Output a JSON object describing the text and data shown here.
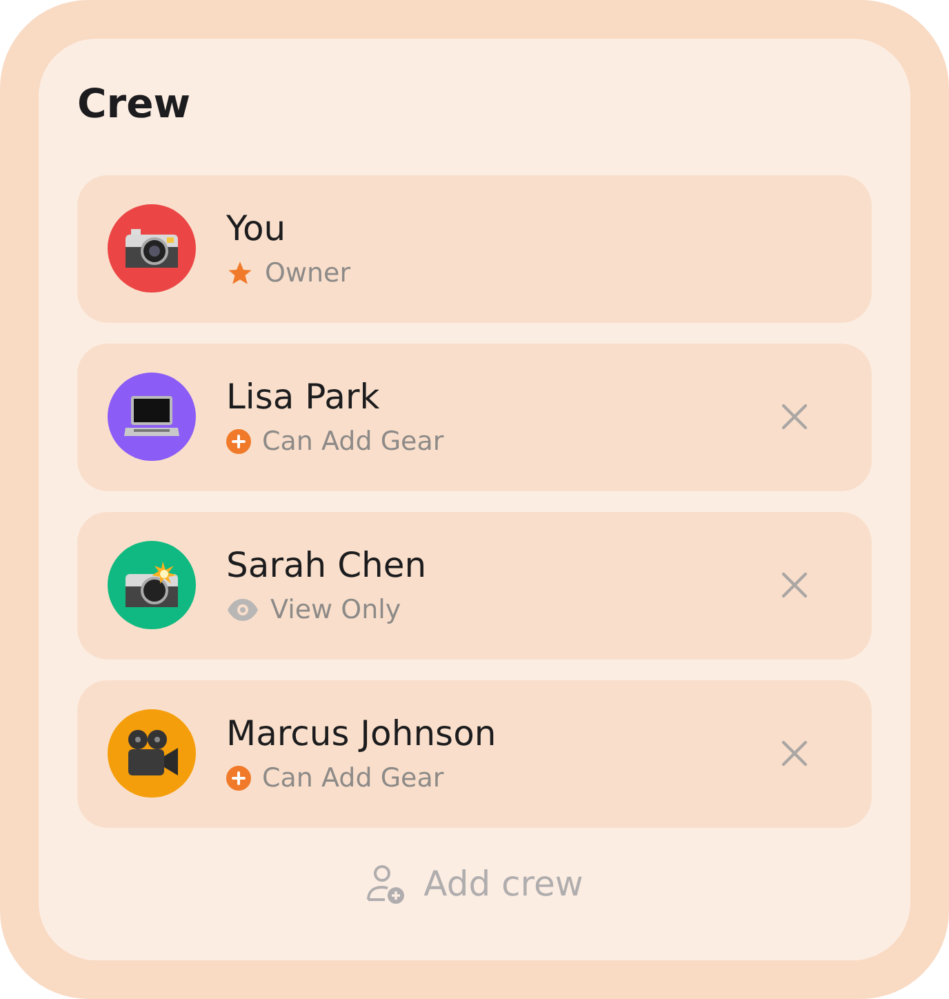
{
  "title": "Crew",
  "members": [
    {
      "name": "You",
      "avatar": {
        "kind": "camera",
        "color": "#ec4545"
      },
      "role": {
        "kind": "owner",
        "label": "Owner"
      },
      "removable": false
    },
    {
      "name": "Lisa Park",
      "avatar": {
        "kind": "laptop",
        "color": "#8b5cf6"
      },
      "role": {
        "kind": "add",
        "label": "Can Add Gear"
      },
      "removable": true
    },
    {
      "name": "Sarah Chen",
      "avatar": {
        "kind": "flash-camera",
        "color": "#10b981"
      },
      "role": {
        "kind": "view",
        "label": "View Only"
      },
      "removable": true
    },
    {
      "name": "Marcus Johnson",
      "avatar": {
        "kind": "movie-camera",
        "color": "#f59e0b"
      },
      "role": {
        "kind": "add",
        "label": "Can Add Gear"
      },
      "removable": true
    }
  ],
  "add_button": "Add crew"
}
